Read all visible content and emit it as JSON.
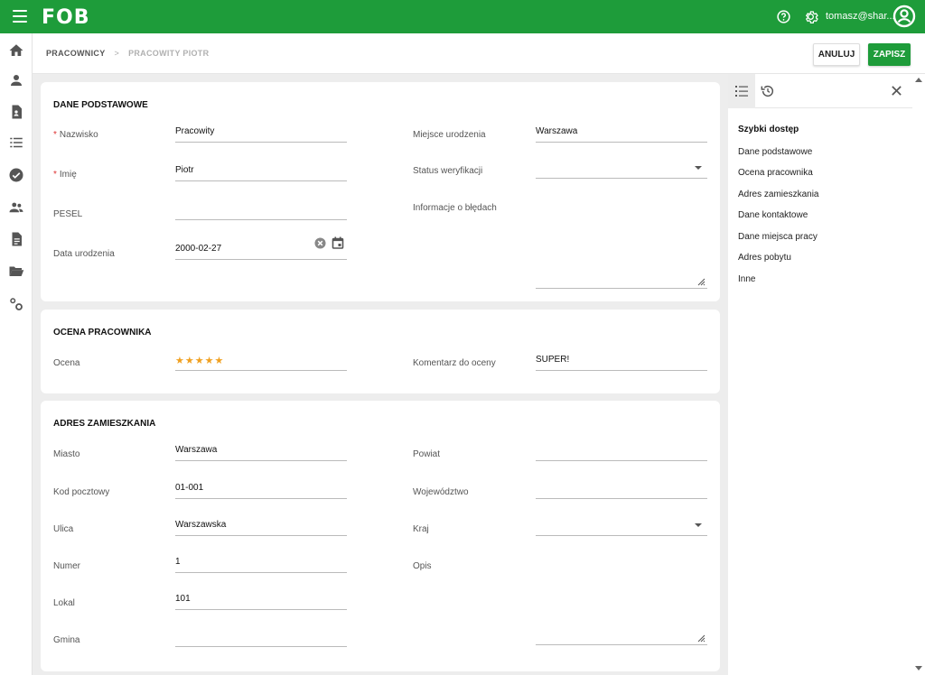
{
  "app": {
    "logo": "FOB",
    "user": "tomasz@shar...",
    "accent": "#1e9c3a"
  },
  "icons": {
    "menu": "hamburger-icon",
    "help": "help-icon",
    "settings": "gear-icon",
    "account": "account-circle-icon"
  },
  "sidebar": {
    "items": [
      "home-icon",
      "person-icon",
      "document-person-icon",
      "list-icon",
      "check-circle-icon",
      "people-icon",
      "document-icon",
      "folder-icon",
      "settings-cogs-icon"
    ]
  },
  "breadcrumb": {
    "root": "PRACOWNICY",
    "current": "PRACOWITY PIOTR"
  },
  "toolbar": {
    "cancel_label": "ANULUJ",
    "save_label": "ZAPISZ"
  },
  "basic": {
    "title": "DANE PODSTAWOWE",
    "surname_label": "Nazwisko",
    "surname_value": "Pracowity",
    "name_label": "Imię",
    "name_value": "Piotr",
    "pesel_label": "PESEL",
    "pesel_value": "",
    "birthdate_label": "Data urodzenia",
    "birthdate_value": "2000-02-27",
    "birthplace_label": "Miejsce urodzenia",
    "birthplace_value": "Warszawa",
    "verification_label": "Status weryfikacji",
    "verification_value": "",
    "errors_label": "Informacje o błędach",
    "errors_value": ""
  },
  "rating": {
    "title": "OCENA PRACOWNIKA",
    "rating_label": "Ocena",
    "stars": "★★★★★",
    "rating_value": 5,
    "rating_max": 5,
    "comment_label": "Komentarz do oceny",
    "comment_value": "SUPER!"
  },
  "address": {
    "title": "ADRES ZAMIESZKANIA",
    "city_label": "Miasto",
    "city_value": "Warszawa",
    "postal_label": "Kod pocztowy",
    "postal_value": "01-001",
    "street_label": "Ulica",
    "street_value": "Warszawska",
    "number_label": "Numer",
    "number_value": "1",
    "flat_label": "Lokal",
    "flat_value": "101",
    "commune_label": "Gmina",
    "commune_value": "",
    "county_label": "Powiat",
    "county_value": "",
    "province_label": "Województwo",
    "province_value": "",
    "country_label": "Kraj",
    "country_value": "",
    "desc_label": "Opis",
    "desc_value": ""
  },
  "quick": {
    "title": "Szybki dostęp",
    "items": [
      "Dane podstawowe",
      "Ocena pracownika",
      "Adres zamieszkania",
      "Dane kontaktowe",
      "Dane miejsca pracy",
      "Adres pobytu",
      "Inne"
    ]
  }
}
